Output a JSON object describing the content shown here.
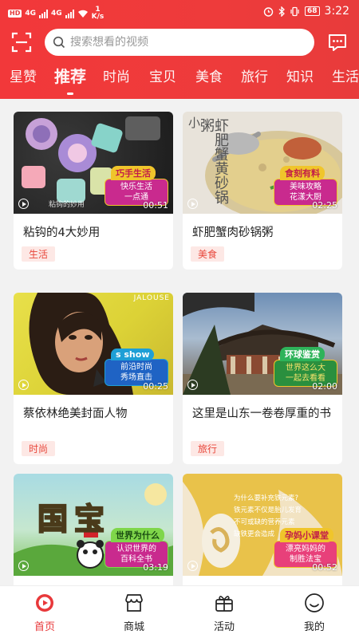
{
  "status_bar": {
    "network_badge": "HD",
    "signal_1": "4G",
    "signal_2": "4G",
    "speed_value": "1",
    "speed_unit": "K/s",
    "battery": "68",
    "time": "3:22"
  },
  "search": {
    "placeholder": "搜索想看的视频"
  },
  "icons": {
    "scan": "scan-icon",
    "message": "message-icon",
    "search": "search-icon"
  },
  "tabs": [
    {
      "label": "星赞"
    },
    {
      "label": "推荐"
    },
    {
      "label": "时尚"
    },
    {
      "label": "宝贝"
    },
    {
      "label": "美食"
    },
    {
      "label": "旅行"
    },
    {
      "label": "知识"
    },
    {
      "label": "生活"
    }
  ],
  "active_tab": "推荐",
  "cards": [
    {
      "title": "粘钩的4大妙用",
      "duration": "00:51",
      "tag": "生活",
      "badge_head": "巧手生活",
      "badge_body": "快乐生活\n一点通",
      "watermark": "粘钩的妙用"
    },
    {
      "title": "虾肥蟹肉砂锅粥",
      "duration": "02:25",
      "tag": "美食",
      "badge_head": "食刻有料",
      "badge_body": "美味攻略\n花漾大厨",
      "overlay": "虾肥蟹黄砂锅粥",
      "overlay_small": "小"
    },
    {
      "title": "蔡依林绝美封面人物",
      "duration": "00:25",
      "tag": "时尚",
      "badge_head": "s show",
      "badge_body": "前沿时尚\n秀场直击",
      "overlay": "JALOUSE"
    },
    {
      "title": "这里是山东一卷卷厚重的书",
      "duration": "02:00",
      "tag": "旅行",
      "badge_head": "环球鉴赏",
      "badge_body": "世界这么大\n一起去看看"
    },
    {
      "title": "",
      "duration": "03:19",
      "tag": "",
      "badge_head": "世界为什么",
      "badge_body": "认识世界的\n百科全书",
      "overlay": "国宝"
    },
    {
      "title": "",
      "duration": "00:52",
      "tag": "",
      "badge_head": "孕妈小课堂",
      "badge_body": "漂亮妈妈的\n制胜法宝",
      "overlay_lines": [
        "为什么要补充铁元素?",
        "铁元素不仅是胎儿发育",
        "不可或缺的营养元素",
        "缺铁更会造成"
      ]
    }
  ],
  "bottom_nav": [
    {
      "label": "首页",
      "icon": "home-play-icon",
      "active": true
    },
    {
      "label": "商城",
      "icon": "shop-icon",
      "active": false
    },
    {
      "label": "活动",
      "icon": "gift-icon",
      "active": false
    },
    {
      "label": "我的",
      "icon": "smiley-icon",
      "active": false
    }
  ],
  "colors": {
    "accent": "#e8383a",
    "header": "#ef3a3b",
    "tag_bg": "#fde8e5",
    "badge_yellow": "#f0c52b",
    "badge_magenta": "#c92a8e"
  }
}
